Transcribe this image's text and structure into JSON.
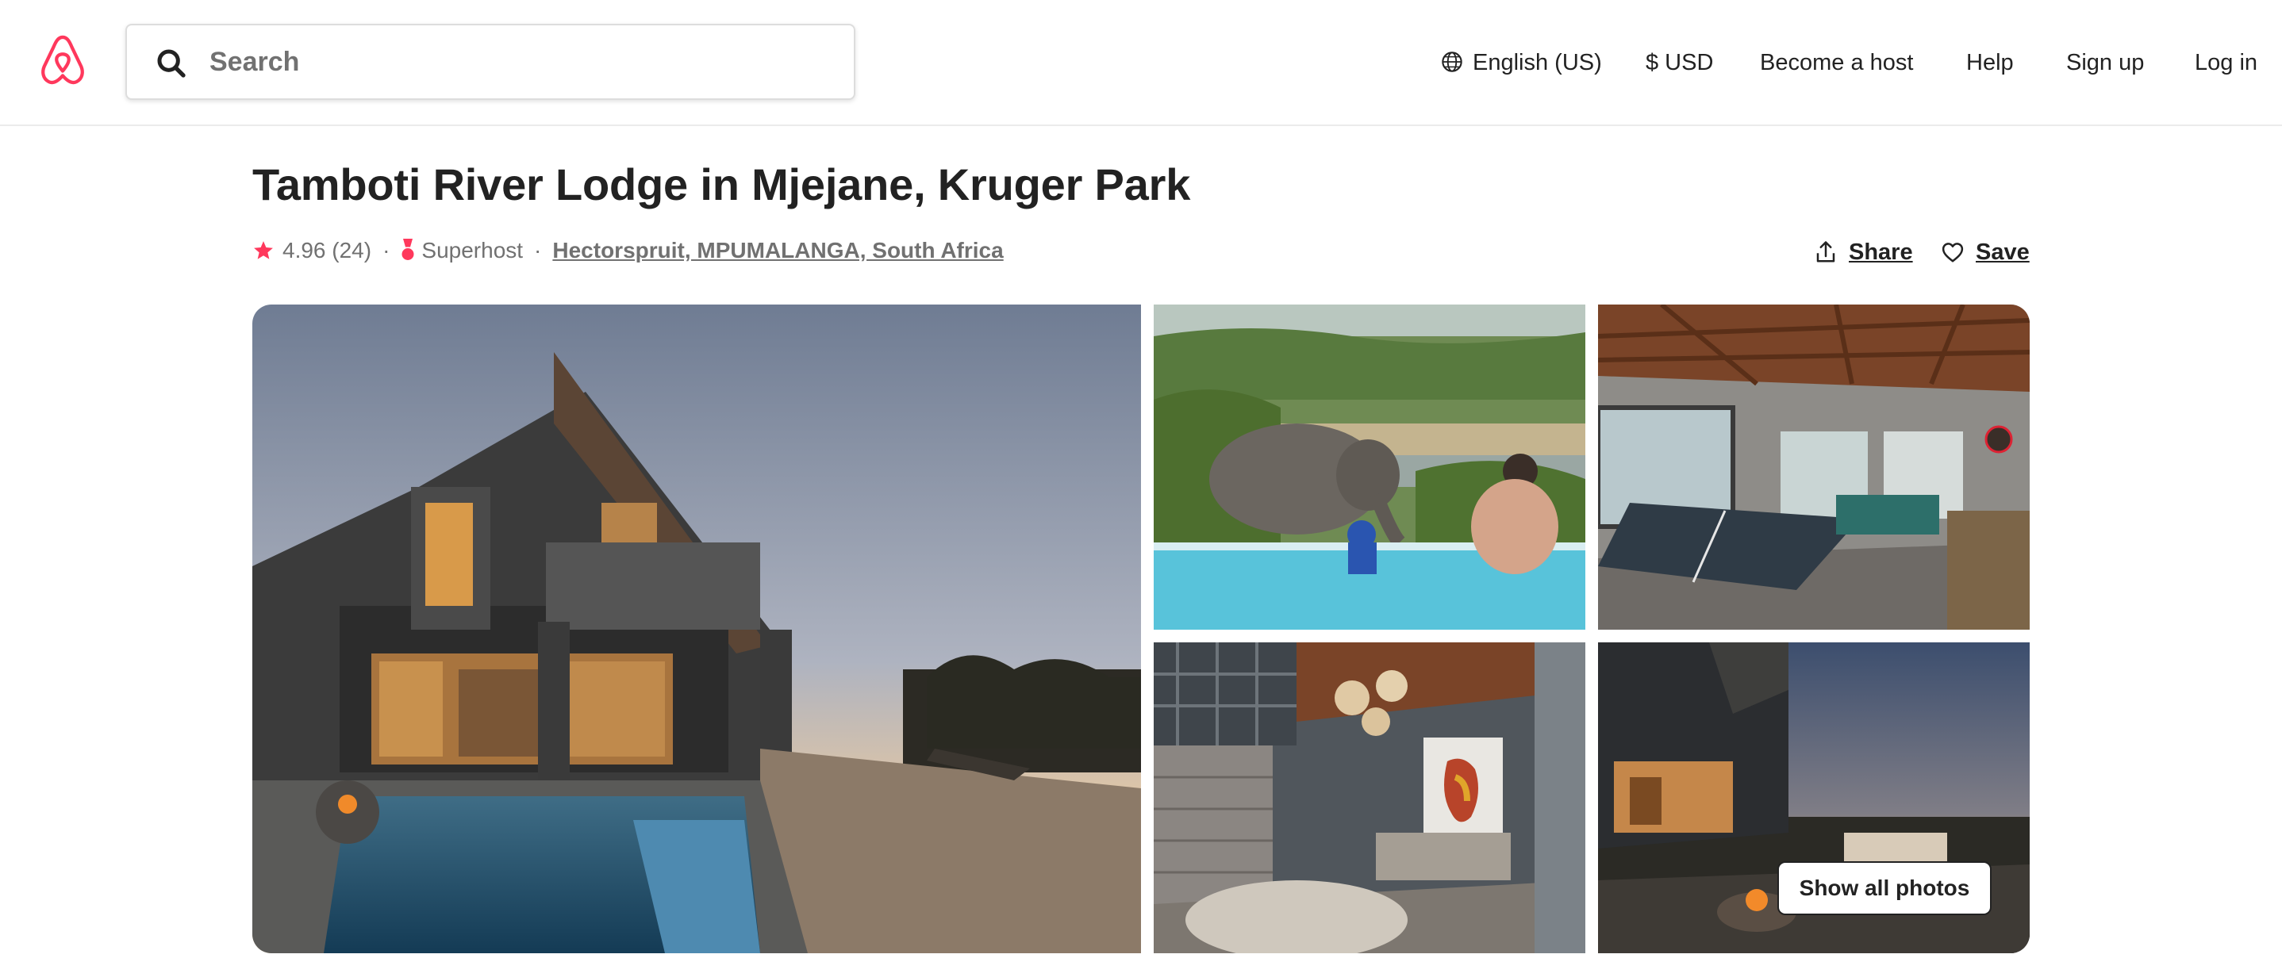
{
  "header": {
    "logo_icon": "airbnb-logo-icon",
    "search": {
      "placeholder": "Search",
      "icon": "search-icon"
    },
    "nav": {
      "language": "English (US)",
      "language_icon": "globe-icon",
      "currency": "$ USD",
      "become_host": "Become a host",
      "help": "Help",
      "sign_up": "Sign up",
      "log_in": "Log in"
    }
  },
  "listing": {
    "title": "Tamboti River Lodge in Mjejane, Kruger Park",
    "rating": "4.96",
    "reviews": "(24)",
    "superhost": "Superhost",
    "separator": "·",
    "location": "Hectorspruit, MPUMALANGA, South Africa",
    "share_label": "Share",
    "save_label": "Save"
  },
  "gallery": {
    "photos": [
      {
        "name": "lodge-exterior-pool-dusk"
      },
      {
        "name": "elephant-by-infinity-pool"
      },
      {
        "name": "games-room-table-tennis"
      },
      {
        "name": "lounge-interior-africa-art"
      },
      {
        "name": "deck-sunset-fire-pit"
      }
    ],
    "show_all_label": "Show all photos"
  },
  "colors": {
    "brand": "#FF385C",
    "text": "#222222",
    "muted": "#717171",
    "border": "#DDDDDD"
  }
}
